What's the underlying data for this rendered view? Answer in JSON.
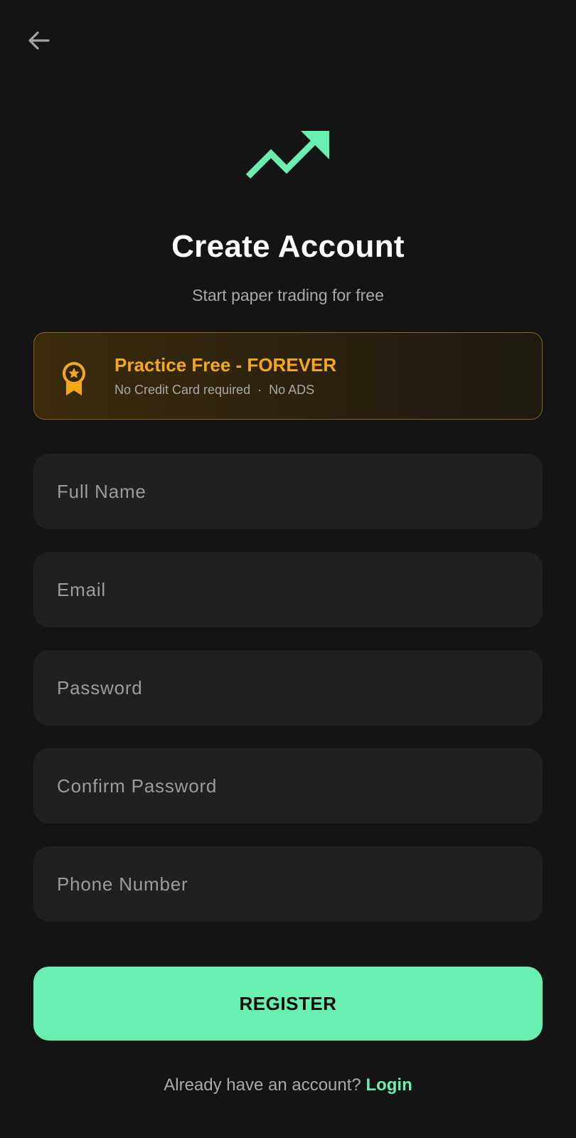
{
  "header": {
    "back_icon": "arrow-left-icon"
  },
  "logo": {
    "icon": "trending-up-arrow-icon",
    "color": "#69f0b1"
  },
  "title": "Create Account",
  "subtitle": "Start paper trading for free",
  "promo": {
    "icon": "award-badge-icon",
    "title": "Practice Free - FOREVER",
    "sub_left": "No Credit Card required",
    "separator": "·",
    "sub_right": "No ADS",
    "accent_color": "#f6a81b"
  },
  "form": {
    "full_name": {
      "placeholder": "Full Name",
      "value": ""
    },
    "email": {
      "placeholder": "Email",
      "value": ""
    },
    "password": {
      "placeholder": "Password",
      "value": ""
    },
    "confirm_password": {
      "placeholder": "Confirm Password",
      "value": ""
    },
    "phone": {
      "placeholder": "Phone Number",
      "value": ""
    }
  },
  "register_label": "REGISTER",
  "footer": {
    "prompt": "Already have an account?",
    "login_label": "Login"
  },
  "colors": {
    "background": "#141414",
    "field_background": "#202020",
    "primary": "#69f0b1",
    "warning": "#f6a81b"
  }
}
